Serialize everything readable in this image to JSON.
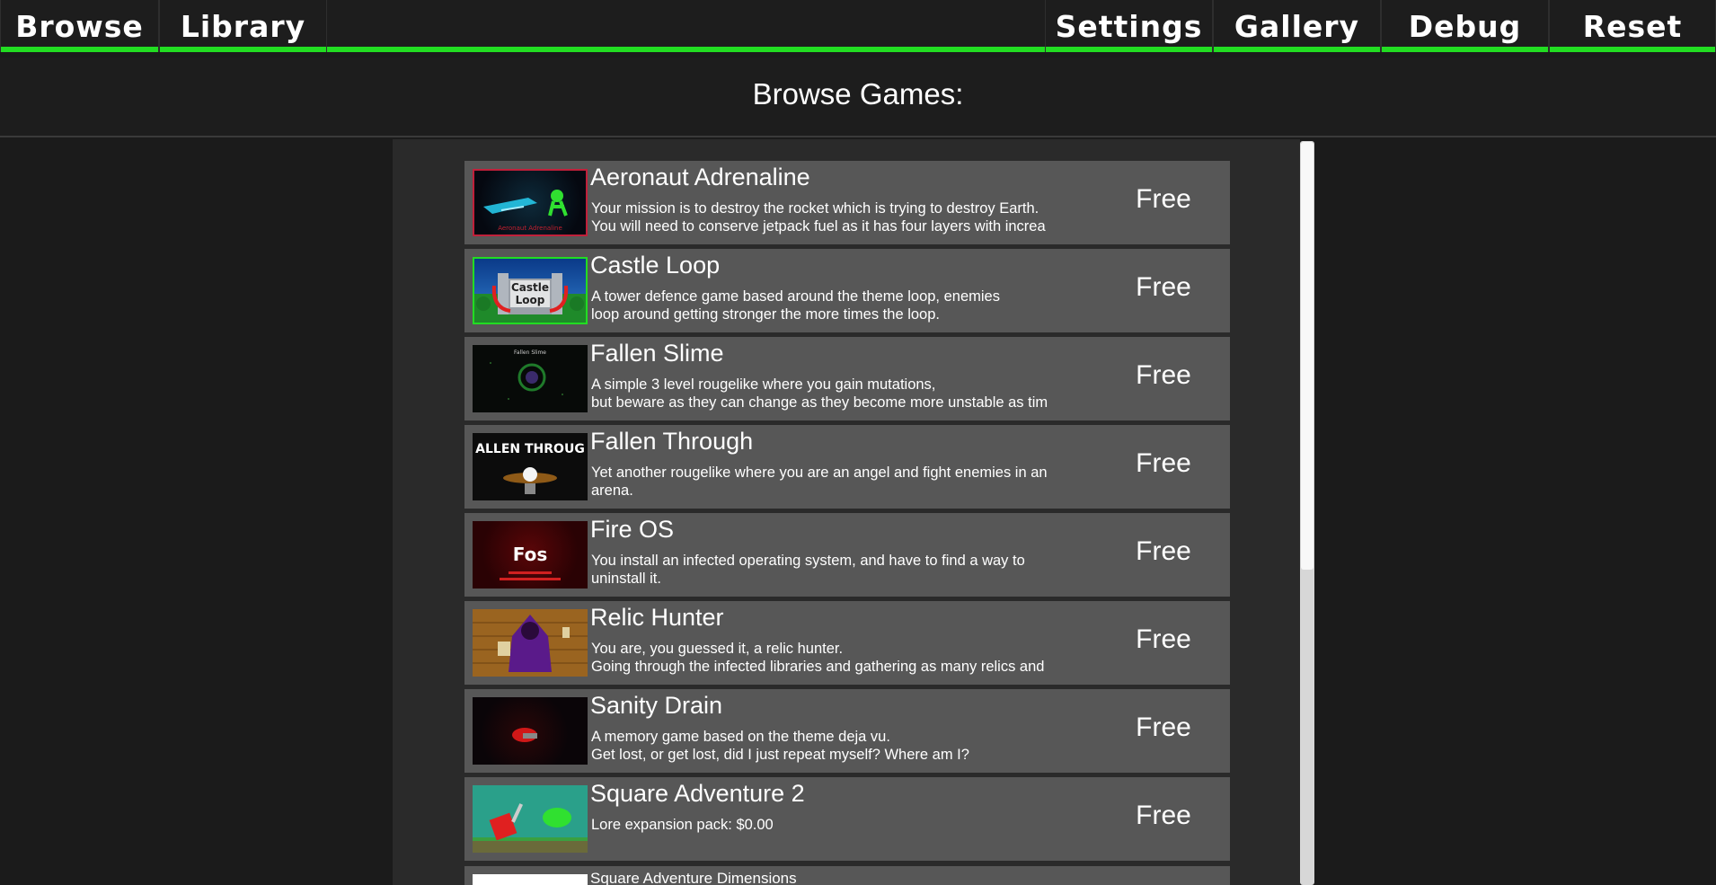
{
  "nav": {
    "browse": "Browse",
    "library": "Library",
    "settings": "Settings",
    "gallery": "Gallery",
    "debug": "Debug",
    "reset": "Reset"
  },
  "colors": {
    "accent": "#22dd22",
    "row_bg": "#575757",
    "panel_bg": "#2a2a2a"
  },
  "page_title": "Browse Games:",
  "games": [
    {
      "title": "Aeronaut Adrenaline",
      "desc": "Your mission is to destroy the rocket which is trying to destroy Earth.\nYou will need to conserve jetpack fuel as it has four layers with increa",
      "price": "Free",
      "thumb_label": "Aeronaut Adrenaline"
    },
    {
      "title": "Castle Loop",
      "desc": "A tower defence game based around the theme loop, enemies\nloop around getting stronger the more times the loop.",
      "price": "Free",
      "thumb_label": "Castle Loop"
    },
    {
      "title": "Fallen Slime",
      "desc": "A simple 3 level rougelike where you gain mutations,\nbut beware as they can change as they become more unstable as tim",
      "price": "Free",
      "thumb_label": "Fallen Slime"
    },
    {
      "title": "Fallen Through",
      "desc": "Yet another rougelike where you are an angel and fight enemies in an\narena.",
      "price": "Free",
      "thumb_label": "ALLEN THROUG"
    },
    {
      "title": "Fire OS",
      "desc": "You install an infected operating system, and have to find a way to\nuninstall it.",
      "price": "Free",
      "thumb_label": "Fos"
    },
    {
      "title": "Relic Hunter",
      "desc": "You are, you guessed it, a relic hunter.\nGoing through the infected libraries and gathering as many relics and",
      "price": "Free",
      "thumb_label": ""
    },
    {
      "title": "Sanity Drain",
      "desc": "A memory game based on the theme deja vu.\nGet lost, or get lost, did I just repeat myself? Where am I?",
      "price": "Free",
      "thumb_label": ""
    },
    {
      "title": "Square Adventure 2",
      "desc": "Lore expansion pack: $0.00",
      "price": "Free",
      "thumb_label": ""
    },
    {
      "title": "Square Adventure Dimensions",
      "desc": "",
      "price": "",
      "thumb_label": ""
    }
  ]
}
